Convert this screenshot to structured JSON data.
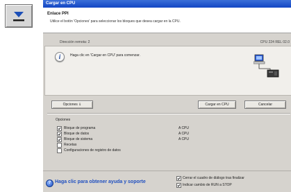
{
  "window": {
    "title": "Cargar en CPU"
  },
  "header": {
    "title": "Enlace PPI",
    "description": "Utilice el botón 'Opciones' para seleccionar los bloques que desea cargar en la CPU."
  },
  "info": {
    "left": "Dirección remota: 2",
    "right": "CPU 224 REL 02.0"
  },
  "panel": {
    "message": "Haga clic en 'Cargar en CPU' para comenzar."
  },
  "buttons": {
    "options": "Opciones ⇓",
    "upload": "Cargar en CPU",
    "cancel": "Cancelar"
  },
  "options": {
    "label": "Opciones",
    "items": [
      {
        "label": "Bloque de programa",
        "checked": true,
        "target": "A  CPU"
      },
      {
        "label": "Bloque de datos",
        "checked": true,
        "target": "A  CPU"
      },
      {
        "label": "Bloque de sistema",
        "checked": true,
        "target": "A  CPU"
      },
      {
        "label": "Recetas",
        "checked": false,
        "target": ""
      },
      {
        "label": "Configuraciones de registro de datos",
        "checked": false,
        "target": ""
      }
    ]
  },
  "footer": {
    "help": "Haga clic para obtener ayuda y soporte",
    "close_option": "Cerrar el cuadro de diálogo tras finalizar",
    "mode_option": "Indicar cambio de RUN a STOP"
  }
}
